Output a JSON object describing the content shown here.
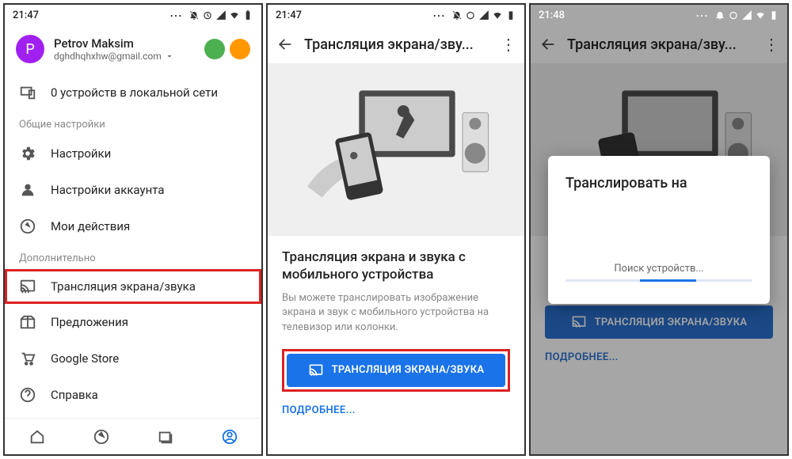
{
  "p1": {
    "time": "21:47",
    "user": {
      "name": "Petrov Maksim",
      "email": "dghdhqhxhw@gmail.com"
    },
    "devices_row": "0 устройств в локальной сети",
    "section_general": "Общие настройки",
    "row_settings": "Настройки",
    "row_account": "Настройки аккаунта",
    "row_activity": "Мои действия",
    "section_more": "Дополнительно",
    "row_cast": "Трансляция экрана/звука",
    "row_offers": "Предложения",
    "row_store": "Google Store",
    "row_help": "Справка"
  },
  "p2": {
    "time": "21:47",
    "title": "Трансляция экрана/зву...",
    "heading": "Трансляция экрана и звука с мобильного устройства",
    "desc": "Вы можете транслировать изображение экрана и звук с мобильного устройства на телевизор или колонки.",
    "button": "ТРАНСЛЯЦИЯ ЭКРАНА/ЗВУКА",
    "more": "ПОДРОБНЕЕ..."
  },
  "p3": {
    "time": "21:48",
    "title": "Трансляция экрана/зву...",
    "dialog_title": "Транслировать на",
    "dialog_status": "Поиск устройств...",
    "button": "ТРАНСЛЯЦИЯ ЭКРАНА/ЗВУКА",
    "more": "ПОДРОБНЕЕ..."
  }
}
